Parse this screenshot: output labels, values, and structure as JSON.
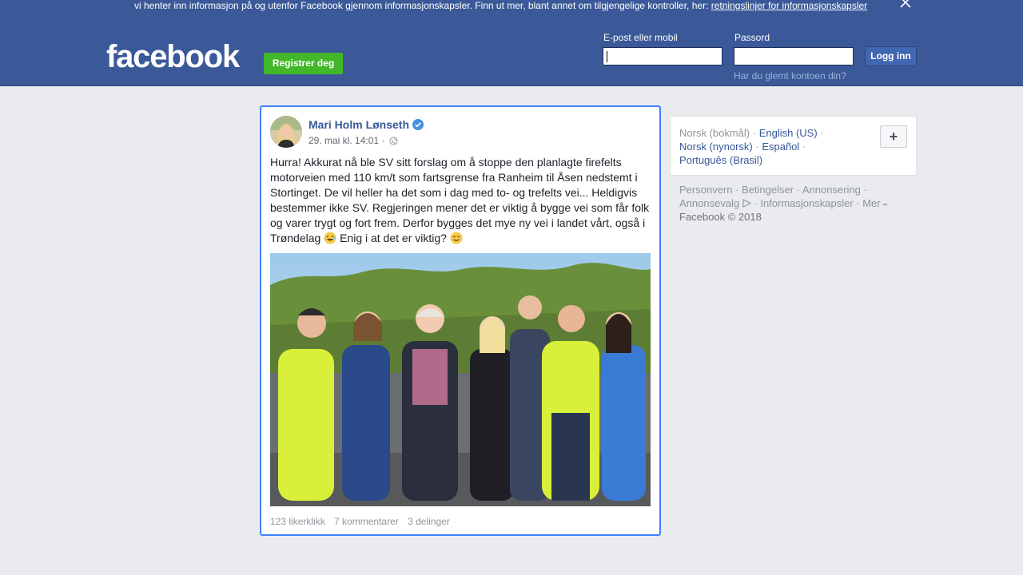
{
  "cookie_banner": {
    "text": "vi henter inn informasjon på og utenfor Facebook gjennom informasjonskapsler. Finn ut mer, blant annet om tilgjengelige kontroller, her: ",
    "link": "retningslinjer for informasjonskapsler"
  },
  "header": {
    "logo": "facebook",
    "register_label": "Registrer deg",
    "email_label": "E-post eller mobil",
    "password_label": "Passord",
    "email_value": "",
    "password_value": "",
    "login_label": "Logg inn",
    "forgot_label": "Har du glemt kontoen din?"
  },
  "post": {
    "author": "Mari Holm Lønseth",
    "timestamp": "29. mai kl. 14:01 ·",
    "text_lines": [
      "Hurra! Akkurat nå ble SV sitt forslag om å stoppe den planlagte firefelts",
      "motorveien med 110 km/t som fartsgrense fra Ranheim til Åsen nedstemt i",
      "Stortinget. De vil heller ha det som i dag med to- og trefelts vei... Heldigvis",
      "bestemmer ikke SV. Regjeringen mener det er viktig å bygge vei som får folk",
      "og varer trygt og fort frem. Derfor bygges det mye ny vei i landet vårt, også i",
      "Trøndelag",
      "Enig i at det er viktig?"
    ],
    "likes": "123 likerklikk",
    "comments": "7 kommentarer",
    "shares": "3 delinger"
  },
  "languages": {
    "current": "Norsk (bokmål) ·",
    "english": "English (US)",
    "sep1": " ·",
    "nynorsk": "Norsk (nynorsk)",
    "sep2": " · ",
    "espanol": "Español",
    "sep3": " ·",
    "portugues": "Português (Brasil)",
    "more_button": "+"
  },
  "footer_links": {
    "line1": "Personvern · Betingelser · Annonsering ·",
    "line2a": "Annonsevalg",
    "line2b": " · Informasjonskapsler · Mer",
    "copyright": "Facebook © 2018"
  },
  "colors": {
    "brand_blue": "#3b5998",
    "register_green": "#42b72a",
    "link_blue": "#365899",
    "focus_border": "#4080ff"
  },
  "icons": [
    "close-icon",
    "verified-badge-icon",
    "globe-icon",
    "laughing-emoji-icon",
    "smiling-emoji-icon",
    "adchoices-icon",
    "dropdown-caret-icon"
  ]
}
